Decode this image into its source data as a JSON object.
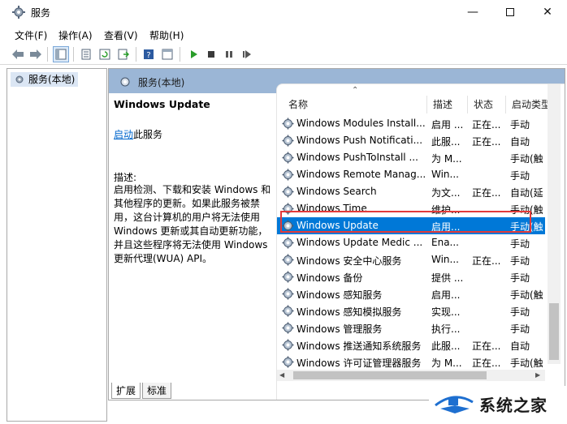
{
  "window": {
    "title": "服务"
  },
  "menu": [
    "文件(F)",
    "操作(A)",
    "查看(V)",
    "帮助(H)"
  ],
  "tree": {
    "item": "服务(本地)"
  },
  "panel": {
    "header": "服务(本地)",
    "selected_title": "Windows Update",
    "start_link": "启动",
    "start_suffix": "此服务",
    "desc_label": "描述:",
    "desc_text": "启用检测、下载和安装 Windows 和其他程序的更新。如果此服务被禁用，这台计算机的用户将无法使用 Windows 更新或其自动更新功能，并且这些程序将无法使用 Windows 更新代理(WUA) API。"
  },
  "columns": [
    "名称",
    "描述",
    "状态",
    "启动类型"
  ],
  "rows": [
    {
      "name": "Windows Modules Install...",
      "desc": "启用 ...",
      "status": "正在...",
      "type": "手动"
    },
    {
      "name": "Windows Push Notificati...",
      "desc": "此服...",
      "status": "正在...",
      "type": "自动"
    },
    {
      "name": "Windows PushToInstall ...",
      "desc": "为 M...",
      "status": "",
      "type": "手动(触"
    },
    {
      "name": "Windows Remote Manag...",
      "desc": "Win...",
      "status": "",
      "type": "手动"
    },
    {
      "name": "Windows Search",
      "desc": "为文...",
      "status": "正在...",
      "type": "自动(延"
    },
    {
      "name": "Windows Time",
      "desc": "维护...",
      "status": "",
      "type": "手动(触"
    },
    {
      "name": "Windows Update",
      "desc": "启用...",
      "status": "",
      "type": "手动(触",
      "selected": true
    },
    {
      "name": "Windows Update Medic ...",
      "desc": "Ena...",
      "status": "",
      "type": "手动"
    },
    {
      "name": "Windows 安全中心服务",
      "desc": "Win...",
      "status": "正在...",
      "type": "手动"
    },
    {
      "name": "Windows 备份",
      "desc": "提供 ...",
      "status": "",
      "type": "手动"
    },
    {
      "name": "Windows 感知服务",
      "desc": "启用...",
      "status": "",
      "type": "手动(触"
    },
    {
      "name": "Windows 感知模拟服务",
      "desc": "实现...",
      "status": "",
      "type": "手动"
    },
    {
      "name": "Windows 管理服务",
      "desc": "执行...",
      "status": "",
      "type": "手动"
    },
    {
      "name": "Windows 推送通知系统服务",
      "desc": "此服...",
      "status": "正在...",
      "type": "自动"
    },
    {
      "name": "Windows 许可证管理器服务",
      "desc": "为 M...",
      "status": "正在...",
      "type": "手动(触"
    }
  ],
  "tabs": [
    "扩展",
    "标准"
  ],
  "watermark": {
    "text": "系统之家"
  },
  "colors": {
    "selection": "#0078d7",
    "panel_header": "#9bb6d6",
    "highlight_box": "#e23a3a",
    "link": "#0066cc"
  }
}
